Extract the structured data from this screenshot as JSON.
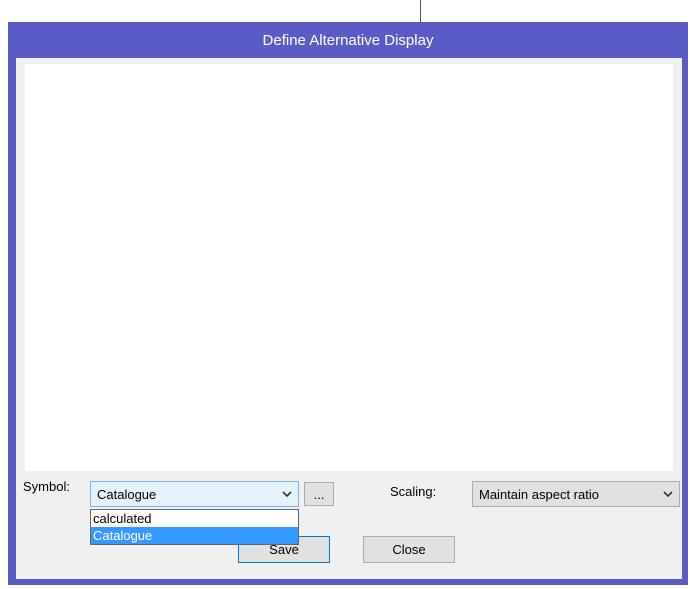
{
  "dialog": {
    "title": "Define Alternative Display",
    "accent_color": "#5b5bc8"
  },
  "symbol": {
    "label": "Symbol:",
    "selected": "Catalogue",
    "options": [
      "calculated",
      "Catalogue"
    ],
    "dropdown_open": true
  },
  "browse_button": {
    "label": "..."
  },
  "scaling": {
    "label": "Scaling:",
    "selected": "Maintain aspect ratio"
  },
  "buttons": {
    "save": "Save",
    "close": "Close"
  },
  "icons": {
    "combo_arrow": "chevron-down-icon"
  }
}
